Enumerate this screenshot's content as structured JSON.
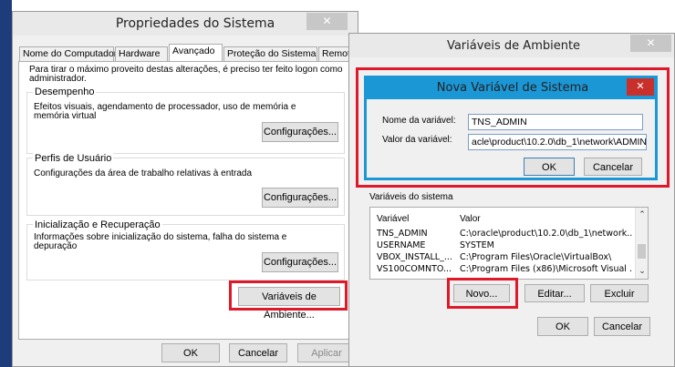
{
  "sys": {
    "title": "Propriedades do Sistema",
    "tabs": [
      "Nome do Computador",
      "Hardware",
      "Avançado",
      "Proteção do Sistema",
      "Remoto"
    ],
    "admin_note": "Para tirar o máximo proveito destas alterações, é preciso ter feito logon como administrador.",
    "perf_title": "Desempenho",
    "perf_text": "Efeitos visuais, agendamento de processador, uso de memória e memória virtual",
    "profiles_title": "Perfis de Usuário",
    "profiles_text": "Configurações da área de trabalho relativas à entrada",
    "startup_title": "Inicialização e Recuperação",
    "startup_text": "Informações sobre inicialização do sistema, falha do sistema e depuração",
    "settings_label": "Configurações...",
    "env_button": "Variáveis de Ambiente...",
    "ok": "OK",
    "cancel": "Cancelar",
    "apply": "Aplicar"
  },
  "env": {
    "title": "Variáveis de Ambiente",
    "sys_vars_label": "Variáveis do sistema",
    "col_var": "Variável",
    "col_val": "Valor",
    "rows": [
      {
        "name": "TNS_ADMIN",
        "value": "C:\\oracle\\product\\10.2.0\\db_1\\network..."
      },
      {
        "name": "USERNAME",
        "value": "SYSTEM"
      },
      {
        "name": "VBOX_INSTALL_...",
        "value": "C:\\Program Files\\Oracle\\VirtualBox\\"
      },
      {
        "name": "VS100COMNTO...",
        "value": "C:\\Program Files (x86)\\Microsoft Visual ..."
      }
    ],
    "new": "Novo...",
    "edit": "Editar...",
    "delete": "Excluir",
    "ok": "OK",
    "cancel": "Cancelar"
  },
  "newvar": {
    "title": "Nova Variável de Sistema",
    "name_label": "Nome da variável:",
    "value_label": "Valor da variável:",
    "name_value": "TNS_ADMIN",
    "value_value": "acle\\product\\10.2.0\\db_1\\network\\ADMIN",
    "ok": "OK",
    "cancel": "Cancelar"
  },
  "colors": {
    "accent_blue": "#1c97d6",
    "highlight_red": "#e0192a",
    "close_red": "#c9302c"
  }
}
